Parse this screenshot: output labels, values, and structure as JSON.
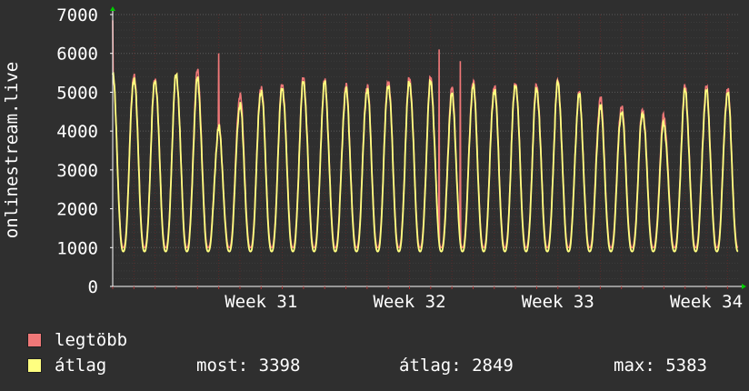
{
  "chart_data": {
    "type": "line",
    "ylabel": "onlinestream.live",
    "ylim": [
      0,
      7000
    ],
    "yticks": [
      0,
      1000,
      2000,
      3000,
      4000,
      5000,
      6000,
      7000
    ],
    "ytick_labels": [
      "0",
      "1000",
      "2000",
      "3000",
      "4000",
      "5000",
      "6000",
      "7000"
    ],
    "xtick_labels": [
      "Week 31",
      "Week 32",
      "Week 33",
      "Week 34"
    ],
    "days_shown": 29.5,
    "grid": true,
    "series": [
      {
        "name": "legtöbb",
        "color": "#f07878",
        "daily_peak_max": [
          5400,
          5500,
          5400,
          5450,
          5500,
          4100,
          4950,
          5200,
          5250,
          5350,
          5250,
          5150,
          5200,
          5350,
          5400,
          5350,
          5050,
          5250,
          5200,
          5300,
          5200,
          5250,
          4950,
          4850,
          4700,
          4600,
          4400,
          5100
        ],
        "daily_trough_max": 1000,
        "spikes": [
          {
            "day": 0.0,
            "value": 6850
          },
          {
            "day": 5.0,
            "value": 6000
          },
          {
            "day": 15.4,
            "value": 6100
          },
          {
            "day": 16.4,
            "value": 5800
          }
        ]
      },
      {
        "name": "átlag",
        "color": "#ffff80",
        "daily_peak": [
          5450,
          5400,
          5350,
          5450,
          5300,
          4050,
          4700,
          5100,
          5150,
          5250,
          5200,
          5050,
          5100,
          5250,
          5300,
          5250,
          4900,
          5150,
          5100,
          5250,
          5100,
          5200,
          4900,
          4650,
          4550,
          4500,
          4200,
          5000
        ],
        "daily_trough": 900
      }
    ]
  },
  "legend": {
    "items": [
      {
        "label": "legtöbb",
        "color": "#f07878"
      },
      {
        "label": "átlag",
        "color": "#ffff80"
      }
    ],
    "stats": {
      "most": "most: 3398",
      "atlag": "átlag: 2849",
      "max": "max: 5383"
    }
  }
}
